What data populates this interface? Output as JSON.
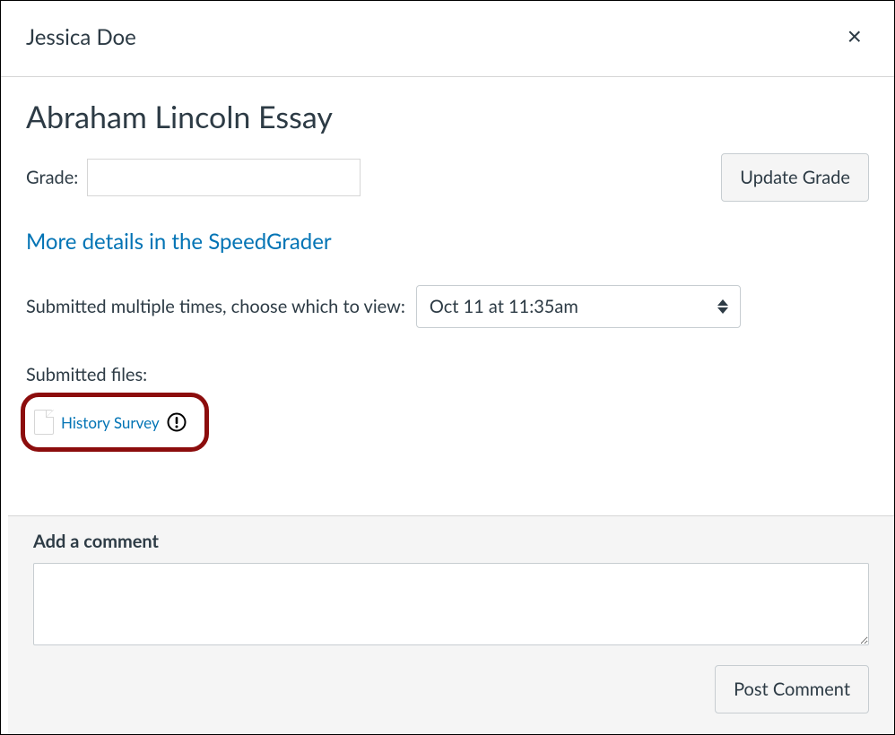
{
  "header": {
    "student_name": "Jessica Doe"
  },
  "assignment": {
    "title": "Abraham Lincoln Essay"
  },
  "grade": {
    "label": "Grade:",
    "value": "",
    "update_button": "Update Grade"
  },
  "speedgrader_link": "More details in the SpeedGrader",
  "submissions": {
    "label": "Submitted multiple times, choose which to view:",
    "selected": "Oct 11 at 11:35am"
  },
  "files": {
    "label": "Submitted files:",
    "items": [
      {
        "name": "History Survey"
      }
    ]
  },
  "comment": {
    "label": "Add a comment",
    "value": "",
    "post_button": "Post Comment"
  }
}
